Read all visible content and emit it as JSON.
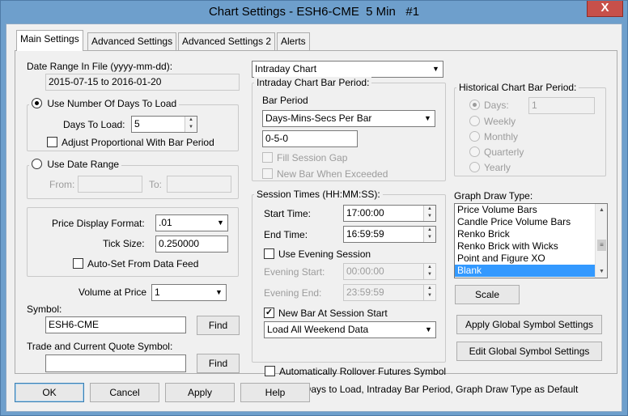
{
  "window": {
    "title": "Chart Settings - ESH6-CME  5 Min   #1",
    "close_glyph": "X"
  },
  "tabs": [
    "Main Settings",
    "Advanced Settings",
    "Advanced Settings 2",
    "Alerts"
  ],
  "date_range_file": {
    "label": "Date Range In File (yyyy-mm-dd):",
    "value": "2015-07-15 to 2016-01-20"
  },
  "days_to_load_group": {
    "radio_label": "Use Number Of Days To Load",
    "days_label": "Days To Load:",
    "days_value": "5",
    "adjust_label": "Adjust Proportional With Bar Period"
  },
  "date_range_group": {
    "radio_label": "Use Date Range",
    "from_label": "From:",
    "to_label": "To:"
  },
  "price_group": {
    "format_label": "Price Display Format:",
    "format_value": ".01",
    "tick_label": "Tick Size:",
    "tick_value": "0.250000",
    "autoset_label": "Auto-Set From Data Feed"
  },
  "volume_at_price": {
    "label": "Volume at Price",
    "value": "1"
  },
  "symbol": {
    "label": "Symbol:",
    "value": "ESH6-CME",
    "find_label": "Find"
  },
  "trade_quote_symbol": {
    "label": "Trade and Current Quote Symbol:",
    "value": "",
    "find_label": "Find"
  },
  "chart_type": {
    "value": "Intraday Chart"
  },
  "intraday_period": {
    "group_label": "Intraday Chart Bar Period:",
    "bar_period_label": "Bar Period",
    "bar_period_type": "Days-Mins-Secs Per Bar",
    "bar_period_value": "0-5-0",
    "fill_gap_label": "Fill Session Gap",
    "new_bar_exceeded_label": "New Bar When Exceeded"
  },
  "session_times": {
    "group_label": "Session Times (HH:MM:SS):",
    "start_label": "Start Time:",
    "start_value": "17:00:00",
    "end_label": "End Time:",
    "end_value": "16:59:59",
    "evening_session_label": "Use Evening Session",
    "evening_start_label": "Evening Start:",
    "evening_start_value": "00:00:00",
    "evening_end_label": "Evening End:",
    "evening_end_value": "23:59:59",
    "new_bar_session_label": "New Bar At Session Start",
    "weekend_value": "Load All Weekend Data"
  },
  "auto_rollover_label": "Automatically Rollover Futures Symbol",
  "save_default_label": "Save Days to Load, Intraday Bar Period, Graph Draw Type as Default",
  "historical_period": {
    "group_label": "Historical Chart Bar Period:",
    "options": [
      "Days:",
      "Weekly",
      "Monthly",
      "Quarterly",
      "Yearly"
    ],
    "days_value": "1"
  },
  "graph_draw_type": {
    "label": "Graph Draw Type:",
    "items": [
      "Price Volume Bars",
      "Candle Price Volume Bars",
      "Renko Brick",
      "Renko Brick with Wicks",
      "Point and Figure XO",
      "Blank"
    ],
    "selected": "Blank",
    "scroll_glyph": "≡"
  },
  "scale_label": "Scale",
  "apply_global_label": "Apply Global Symbol Settings",
  "edit_global_label": "Edit Global Symbol Settings",
  "bottom_buttons": {
    "ok": "OK",
    "cancel": "Cancel",
    "apply": "Apply",
    "help": "Help"
  }
}
